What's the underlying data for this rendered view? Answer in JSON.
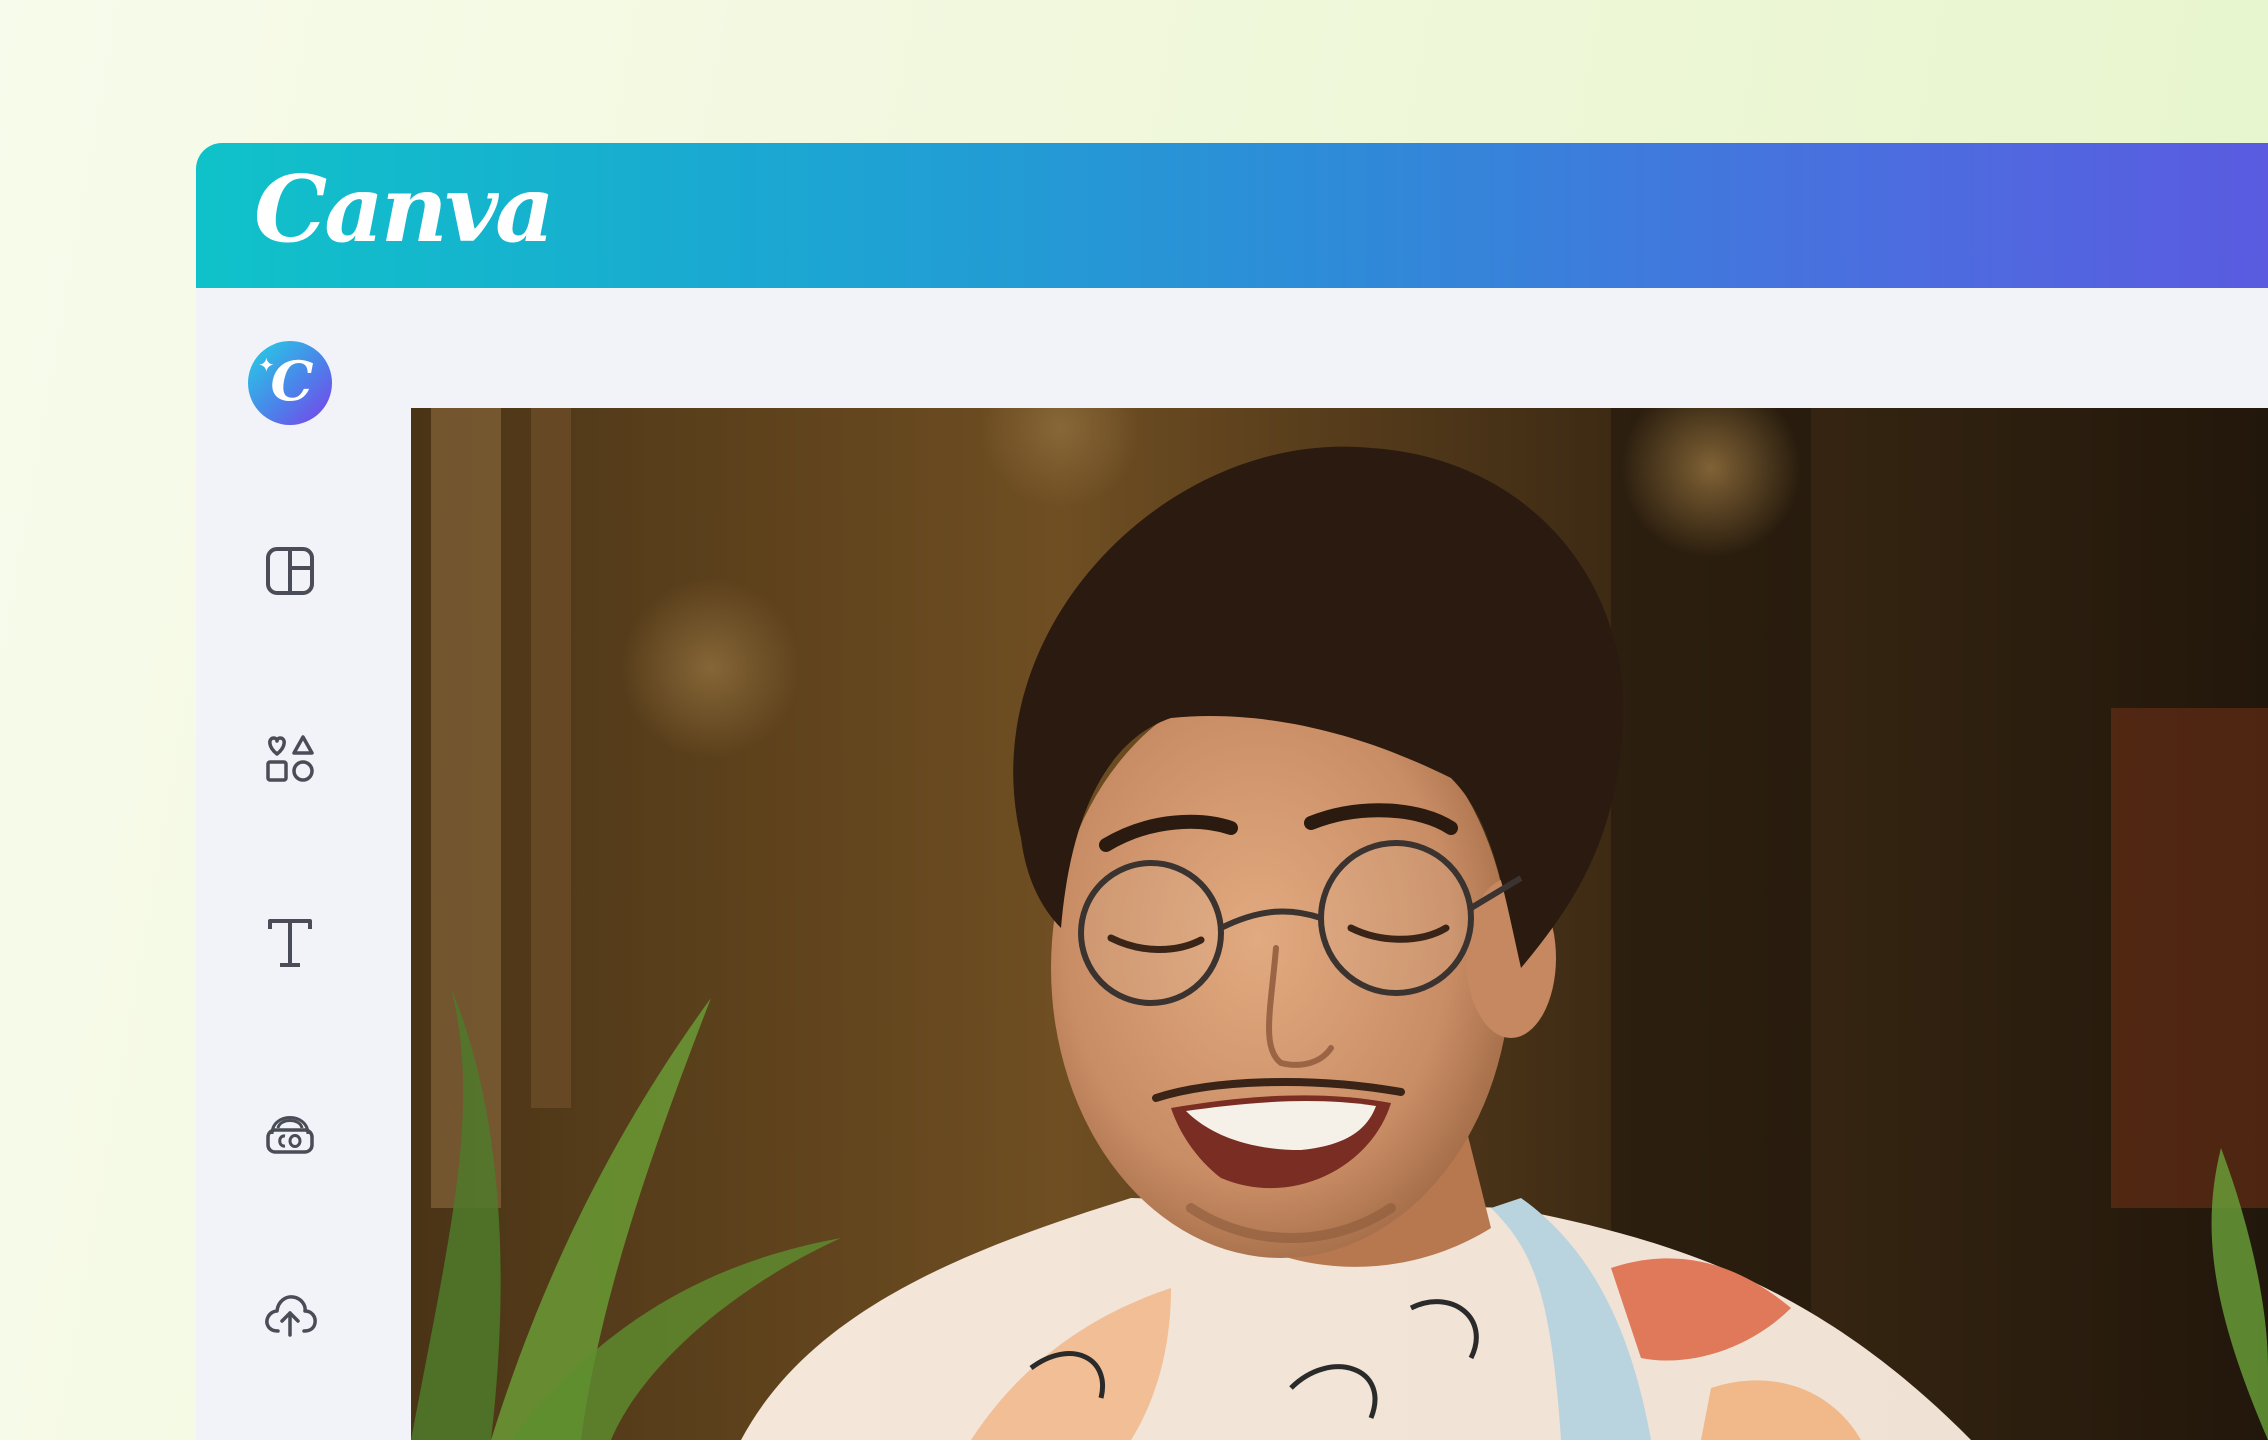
{
  "app": {
    "logo_text": "Canva",
    "header_gradient": [
      "#0fc2c9",
      "#2e8bd8",
      "#5a5be0"
    ],
    "background_color": "#f2f3f8"
  },
  "sidebar": {
    "magic_button": {
      "glyph": "C",
      "icon": "canva-magic-icon"
    },
    "items": [
      {
        "icon": "design-layout-icon"
      },
      {
        "icon": "elements-shapes-icon"
      },
      {
        "icon": "text-icon"
      },
      {
        "icon": "brand-icon"
      },
      {
        "icon": "uploads-cloud-icon"
      }
    ]
  },
  "canvas": {
    "content": "photo"
  }
}
